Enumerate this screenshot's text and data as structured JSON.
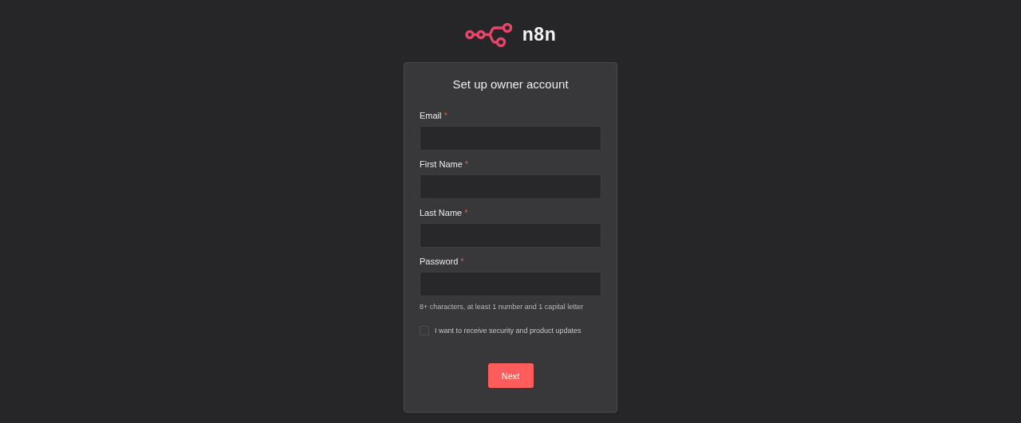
{
  "logo": {
    "wordmark": "n8n"
  },
  "form": {
    "title": "Set up owner account",
    "fields": [
      {
        "label": "Email",
        "required_mark": "*"
      },
      {
        "label": "First Name",
        "required_mark": "*"
      },
      {
        "label": "Last Name",
        "required_mark": "*"
      },
      {
        "label": "Password",
        "required_mark": "*",
        "hint": "8+ characters, at least 1 number and 1 capital letter"
      }
    ],
    "consent": {
      "label": "I want to receive security and product updates",
      "checked": false
    },
    "submit": {
      "label": "Next"
    }
  }
}
